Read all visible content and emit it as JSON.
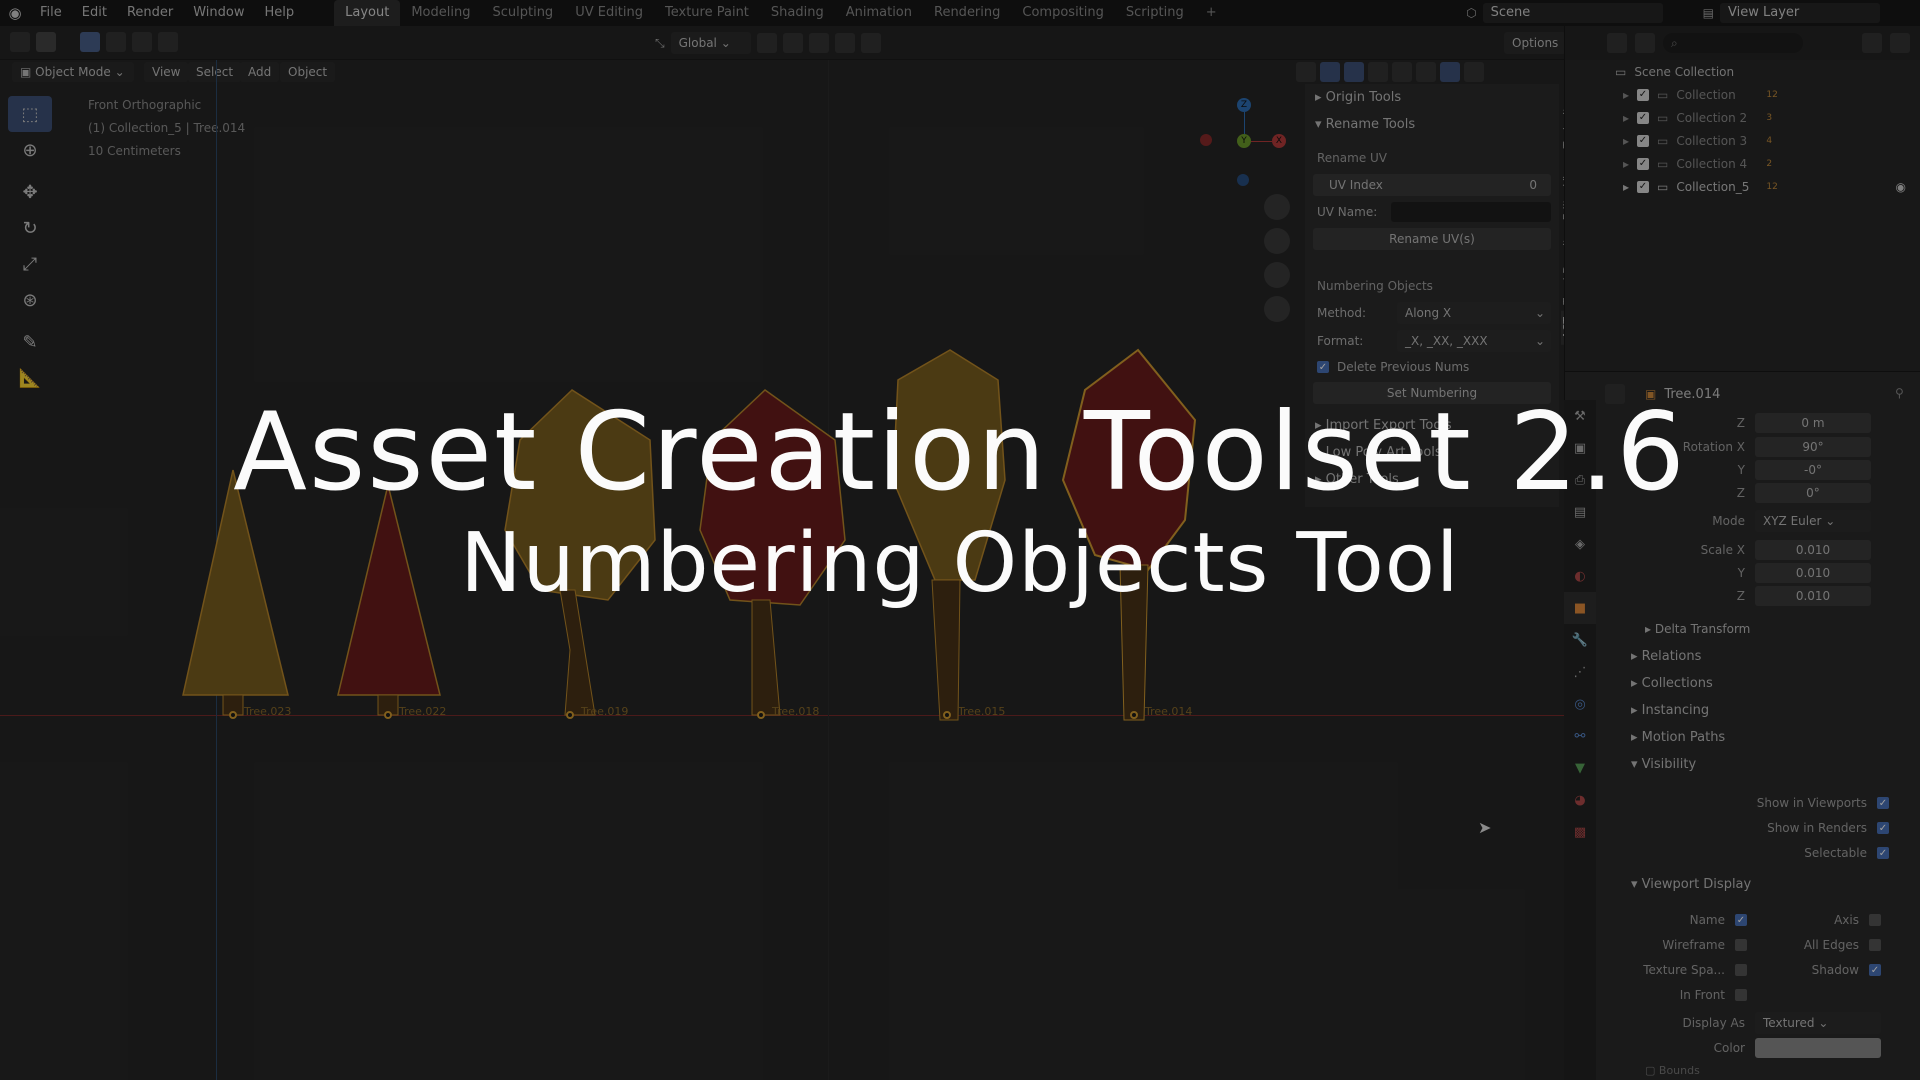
{
  "menubar": {
    "items": [
      "File",
      "Edit",
      "Render",
      "Window",
      "Help"
    ],
    "workspaces": [
      "Layout",
      "Modeling",
      "Sculpting",
      "UV Editing",
      "Texture Paint",
      "Shading",
      "Animation",
      "Rendering",
      "Compositing",
      "Scripting"
    ],
    "active_workspace": "Layout",
    "add_tab": "+",
    "scene": "Scene",
    "view_layer": "View Layer"
  },
  "header": {
    "mode": "Object Mode",
    "view": "View",
    "select": "Select",
    "add": "Add",
    "object": "Object",
    "transform_orientation": "Global",
    "options": "Options"
  },
  "viewport": {
    "view_name": "Front Orthographic",
    "collection_info": "(1) Collection_5 | Tree.014",
    "scale_info": "10 Centimeters",
    "gizmo": {
      "z": "Z",
      "y": "Y",
      "x": "X"
    },
    "trees": [
      {
        "label": "Tree.023",
        "color": "#8a6a22"
      },
      {
        "label": "Tree.022",
        "color": "#7a1f1f"
      },
      {
        "label": "Tree.019",
        "color": "#8a6a22"
      },
      {
        "label": "Tree.018",
        "color": "#7a1f1f"
      },
      {
        "label": "Tree.015",
        "color": "#8a6a22"
      },
      {
        "label": "Tree.014",
        "color": "#7a1f1f"
      }
    ]
  },
  "npanel": {
    "sections": {
      "origin_tools": "Origin Tools",
      "rename_tools": "Rename Tools",
      "import_export": "Import Export Tools",
      "low_poly": "Low Poly Art Tools",
      "other_tools": "Other Tools"
    },
    "rename_uv": "Rename UV",
    "uv_index_label": "UV Index",
    "uv_index_value": "0",
    "uv_name_label": "UV Name:",
    "rename_uv_button": "Rename UV(s)",
    "numbering_objects": "Numbering Objects",
    "method_label": "Method:",
    "method_value": "Along X",
    "format_label": "Format:",
    "format_value": "_X, _XX, _XXX",
    "delete_previous": "Delete Previous Nums",
    "set_numbering": "Set Numbering",
    "tabs": [
      "Item",
      "Tool",
      "View",
      "Edit",
      "Texel Density",
      "ACT"
    ]
  },
  "outliner": {
    "root": "Scene Collection",
    "collections": [
      {
        "name": "Collection",
        "count": "12"
      },
      {
        "name": "Collection 2",
        "count": "3"
      },
      {
        "name": "Collection 3",
        "count": "4"
      },
      {
        "name": "Collection 4",
        "count": "2"
      },
      {
        "name": "Collection_5",
        "count": "12"
      }
    ]
  },
  "properties": {
    "object_name": "Tree.014",
    "location_z_label": "Z",
    "location_z": "0 m",
    "rotation_x_label": "Rotation X",
    "rotation_x": "90°",
    "rotation_y_label": "Y",
    "rotation_y": "-0°",
    "rotation_z_label": "Z",
    "rotation_z": "0°",
    "mode_label": "Mode",
    "mode_value": "XYZ Euler",
    "scale_x_label": "Scale X",
    "scale_x": "0.010",
    "scale_y_label": "Y",
    "scale_y": "0.010",
    "scale_z_label": "Z",
    "scale_z": "0.010",
    "delta_transform": "Delta Transform",
    "relations": "Relations",
    "collections": "Collections",
    "instancing": "Instancing",
    "motion_paths": "Motion Paths",
    "visibility": "Visibility",
    "show_in_viewports": "Show in Viewports",
    "show_in_renders": "Show in Renders",
    "selectable": "Selectable",
    "viewport_display": "Viewport Display",
    "name": "Name",
    "axis": "Axis",
    "wireframe": "Wireframe",
    "all_edges": "All Edges",
    "texture_space": "Texture Spa...",
    "shadow": "Shadow",
    "in_front": "In Front",
    "display_as_label": "Display As",
    "display_as_value": "Textured",
    "color_label": "Color",
    "bounds": "Bounds"
  },
  "overlay": {
    "title": "Asset Creation Toolset 2.6",
    "subtitle": "Numbering Objects Tool"
  }
}
